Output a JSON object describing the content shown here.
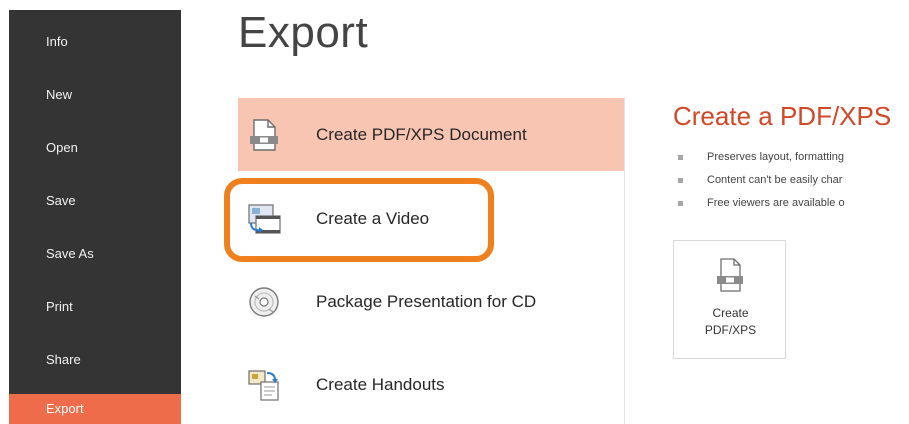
{
  "sidebar": {
    "items": [
      {
        "label": "Info"
      },
      {
        "label": "New"
      },
      {
        "label": "Open"
      },
      {
        "label": "Save"
      },
      {
        "label": "Save As"
      },
      {
        "label": "Print"
      },
      {
        "label": "Share"
      },
      {
        "label": "Export",
        "active": true
      }
    ]
  },
  "page": {
    "title": "Export"
  },
  "options": [
    {
      "label": "Create PDF/XPS Document",
      "icon": "pdf-document-icon",
      "selected": true
    },
    {
      "label": "Create a Video",
      "icon": "video-icon",
      "highlighted": true
    },
    {
      "label": "Package Presentation for CD",
      "icon": "cd-icon"
    },
    {
      "label": "Create Handouts",
      "icon": "handouts-icon"
    }
  ],
  "detail": {
    "title": "Create a PDF/XPS",
    "bullets": [
      "Preserves layout, formatting",
      "Content can't be easily char",
      "Free viewers are available o"
    ],
    "button_label": "Create\nPDF/XPS",
    "button_icon": "pdf-document-icon"
  },
  "colors": {
    "sidebar_bg": "#343434",
    "active_nav": "#ef6c4a",
    "selected_option": "#f9c5b3",
    "highlight_ring": "#f0801e",
    "detail_title": "#d24726"
  }
}
